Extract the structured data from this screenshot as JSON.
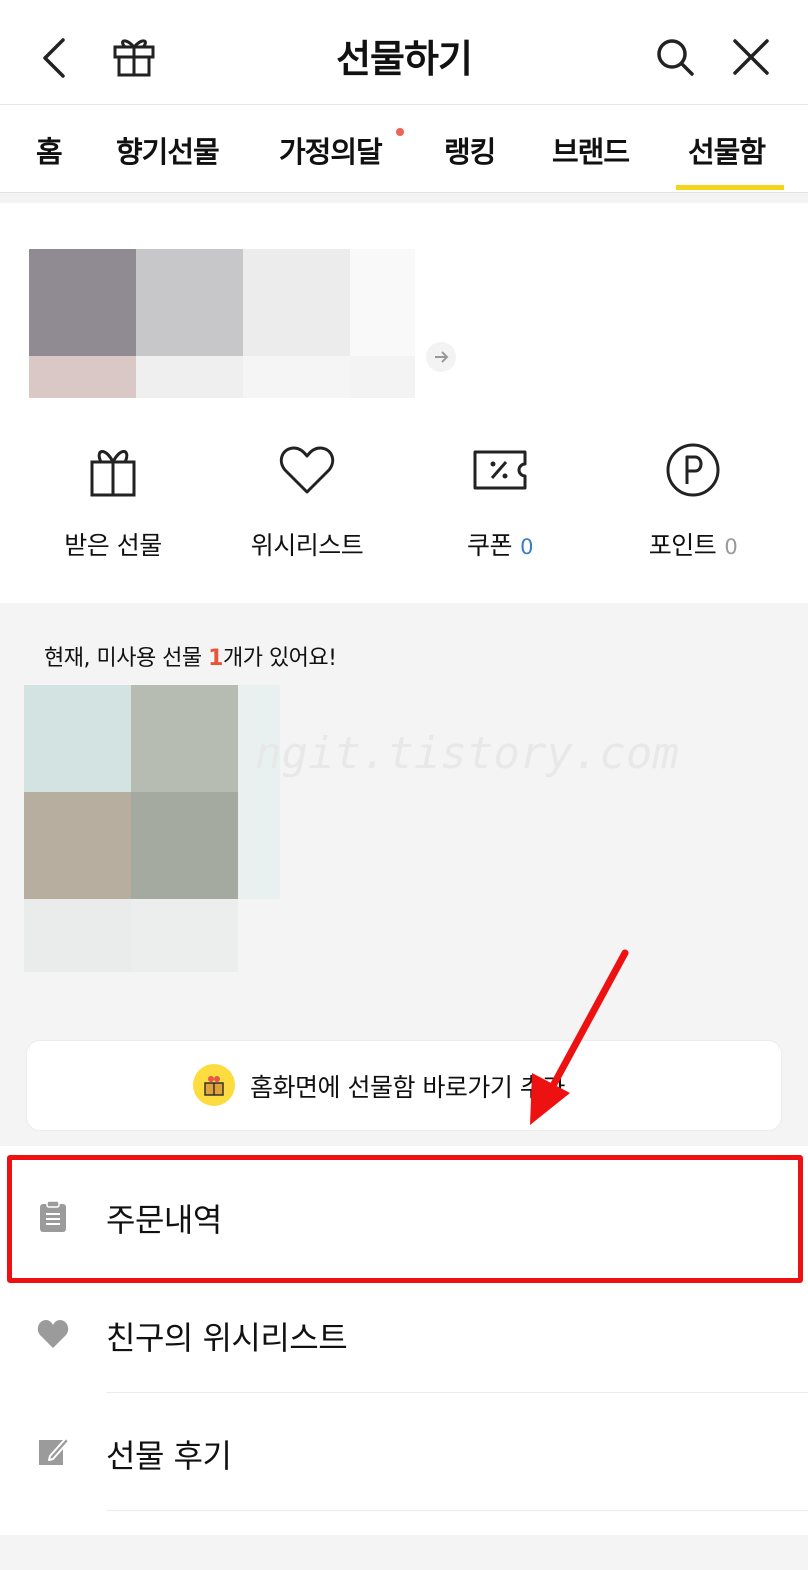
{
  "header": {
    "title": "선물하기",
    "icons": [
      "back-icon",
      "gift-icon",
      "search-icon",
      "close-icon"
    ]
  },
  "tabs": [
    {
      "label": "홈"
    },
    {
      "label": "향기선물"
    },
    {
      "label": "가정의달"
    },
    {
      "label": "랭킹"
    },
    {
      "label": "브랜드"
    },
    {
      "label": "선물함"
    }
  ],
  "quick_menu": [
    {
      "label": "받은 선물",
      "icon": "gift-icon",
      "count": ""
    },
    {
      "label": "위시리스트",
      "icon": "heart-icon",
      "count": ""
    },
    {
      "label": "쿠폰",
      "icon": "coupon-icon",
      "count": "0"
    },
    {
      "label": "포인트",
      "icon": "point-icon",
      "count": "0"
    }
  ],
  "unused": {
    "prefix": "현재, 미사용 선물 ",
    "count": "1",
    "suffix": "개가 있어요!"
  },
  "watermark": "ngit.tistory.com",
  "shortcut": {
    "label": "홈화면에 선물함 바로가기 추가",
    "icon": "gift-box-icon"
  },
  "menu": [
    {
      "label": "주문내역",
      "icon": "clipboard-icon"
    },
    {
      "label": "친구의 위시리스트",
      "icon": "heart-icon"
    },
    {
      "label": "선물 후기",
      "icon": "edit-icon"
    }
  ],
  "colors": {
    "accent_yellow": "#f4d51b",
    "highlight_red": "#ee1111",
    "count_orange": "#e8563a",
    "count_blue": "#3d7bc7",
    "tab_dot": "#f0625a"
  }
}
